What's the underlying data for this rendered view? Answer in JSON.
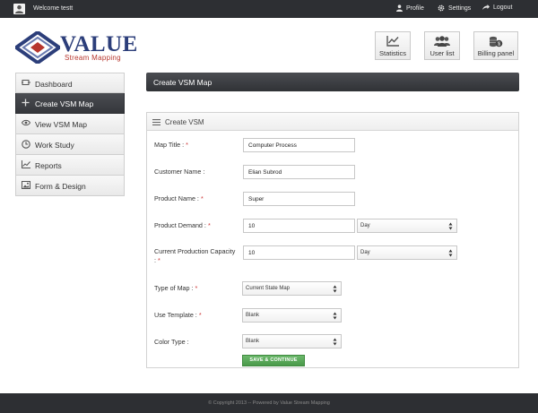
{
  "topbar": {
    "welcome": "Welcome testt",
    "profile_label": "Profile",
    "settings_label": "Settings",
    "logout_label": "Logout"
  },
  "logo": {
    "brand": "VALUE",
    "tagline": "Stream Mapping"
  },
  "toolbar": {
    "statistics_label": "Statistics",
    "userlist_label": "User list",
    "billing_label": "Billing panel"
  },
  "sidebar": {
    "items": [
      {
        "label": "Dashboard",
        "icon": "dashboard-icon"
      },
      {
        "label": "Create VSM Map",
        "icon": "plus-icon",
        "active": true
      },
      {
        "label": "View VSM Map",
        "icon": "eye-icon"
      },
      {
        "label": "Work Study",
        "icon": "clock-icon"
      },
      {
        "label": "Reports",
        "icon": "chart-icon"
      },
      {
        "label": "Form & Design",
        "icon": "picture-icon"
      }
    ]
  },
  "page": {
    "title": "Create VSM Map"
  },
  "form": {
    "panel_title": "Create VSM",
    "map_title": {
      "label": "Map Title :",
      "required": "*",
      "value": "Computer Process"
    },
    "customer_name": {
      "label": "Customer Name :",
      "value": "Elian Subrod"
    },
    "product_name": {
      "label": "Product Name :",
      "required": "*",
      "value": "Super"
    },
    "product_demand": {
      "label": "Product Demand :",
      "required": "*",
      "value": "10",
      "unit": "Day"
    },
    "capacity": {
      "label_line1": "Current Production Capacity",
      "label_line2": ":",
      "required": "*",
      "value": "10",
      "unit": "Day"
    },
    "map_type": {
      "label": "Type of Map :",
      "required": "*",
      "value": "Current State Map"
    },
    "use_template": {
      "label": "Use Template :",
      "required": "*",
      "value": "Blank"
    },
    "color_type": {
      "label": "Color Type :",
      "value": "Blank"
    },
    "submit_label": "SAVE & CONTINUE"
  },
  "footer": {
    "text": "© Copyright 2013 -- Powered by Value Stream Mapping"
  },
  "colors": {
    "dark_bar": "#2d2f33",
    "brand_blue": "#2c3e7a",
    "brand_red": "#b7362d",
    "save_green": "#4a9a4a"
  }
}
